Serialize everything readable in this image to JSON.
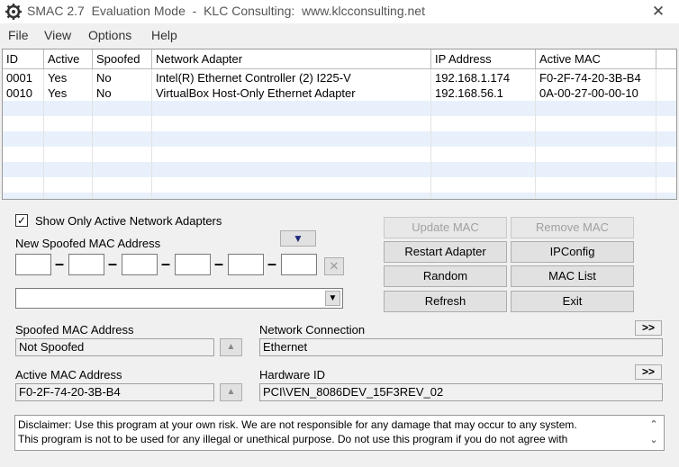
{
  "window": {
    "title": "SMAC 2.7  Evaluation Mode  -  KLC Consulting:  www.klcconsulting.net",
    "close": "✕"
  },
  "menu": [
    "File",
    "View",
    "Options",
    "Help"
  ],
  "table": {
    "headers": [
      "ID",
      "Active",
      "Spoofed",
      "Network Adapter",
      "IP Address",
      "Active MAC"
    ],
    "rows": [
      [
        "0001",
        "Yes",
        "No",
        "Intel(R) Ethernet Controller (2) I225-V",
        "192.168.1.174",
        "F0-2F-74-20-3B-B4"
      ],
      [
        "0010",
        "Yes",
        "No",
        "VirtualBox Host-Only Ethernet Adapter",
        "192.168.56.1",
        "0A-00-27-00-00-10"
      ]
    ]
  },
  "options": {
    "show_only_active_label": "Show Only Active Network Adapters",
    "show_only_active_checked": true
  },
  "new_mac": {
    "label": "New Spoofed MAC Address",
    "dash": "–",
    "clear": "✕",
    "dropdown_arrow": "▼",
    "preset_arrow": "▼"
  },
  "buttons": {
    "update_mac": "Update MAC",
    "remove_mac": "Remove MAC",
    "restart_adapter": "Restart Adapter",
    "ipconfig": "IPConfig",
    "random": "Random",
    "mac_list": "MAC List",
    "refresh": "Refresh",
    "exit": "Exit"
  },
  "info": {
    "spoofed_mac_label": "Spoofed MAC Address",
    "spoofed_mac_value": "Not Spoofed",
    "active_mac_label": "Active MAC Address",
    "active_mac_value": "F0-2F-74-20-3B-B4",
    "network_connection_label": "Network Connection",
    "network_connection_value": "Ethernet",
    "hardware_id_label": "Hardware ID",
    "hardware_id_value": "PCI\\VEN_8086DEV_15F3REV_02",
    "expand": ">>",
    "up_arrow": "▲"
  },
  "disclaimer": {
    "line1": "Disclaimer: Use this program at your own risk.  We are not responsible for any damage that may occur to any system.",
    "line2": "This program is not to be used for any illegal or unethical purpose.  Do not use this program if you do not agree with",
    "scroll_up": "⌃",
    "scroll_down": "⌄"
  }
}
